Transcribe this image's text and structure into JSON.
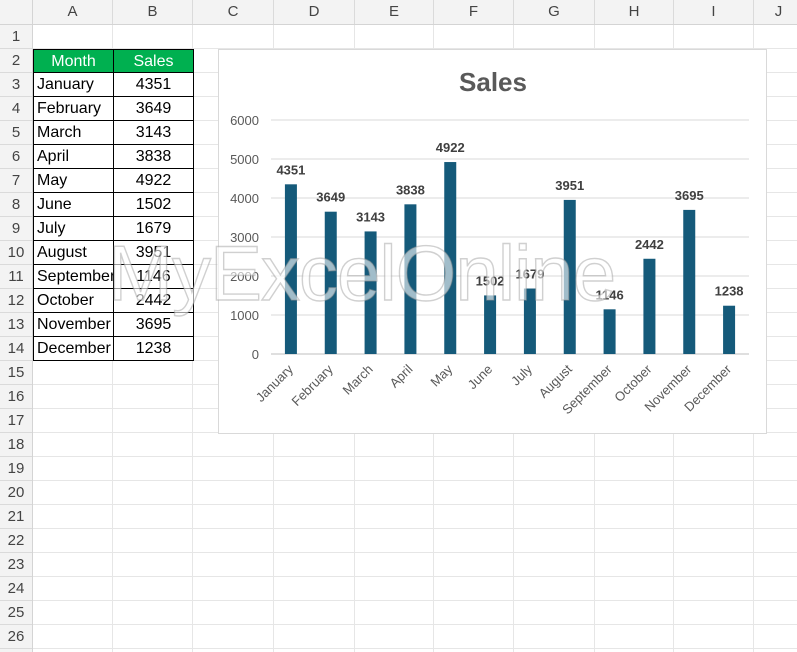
{
  "sheet": {
    "columns": [
      "A",
      "B",
      "C",
      "D",
      "E",
      "F",
      "G",
      "H",
      "I",
      "J"
    ],
    "rows": [
      "1",
      "2",
      "3",
      "4",
      "5",
      "6",
      "7",
      "8",
      "9",
      "10",
      "11",
      "12",
      "13",
      "14",
      "15",
      "16",
      "17",
      "18",
      "19",
      "20",
      "21",
      "22",
      "23",
      "24",
      "25",
      "26"
    ]
  },
  "table": {
    "headers": [
      "Month",
      "Sales"
    ],
    "header_color": "#00b050",
    "rows": [
      {
        "month": "January",
        "sales": "4351"
      },
      {
        "month": "February",
        "sales": "3649"
      },
      {
        "month": "March",
        "sales": "3143"
      },
      {
        "month": "April",
        "sales": "3838"
      },
      {
        "month": "May",
        "sales": "4922"
      },
      {
        "month": "June",
        "sales": "1502"
      },
      {
        "month": "July",
        "sales": "1679"
      },
      {
        "month": "August",
        "sales": "3951"
      },
      {
        "month": "September",
        "sales": "1146"
      },
      {
        "month": "October",
        "sales": "2442"
      },
      {
        "month": "November",
        "sales": "3695"
      },
      {
        "month": "December",
        "sales": "1238"
      }
    ]
  },
  "chart_data": {
    "type": "bar",
    "title": "Sales",
    "categories": [
      "January",
      "February",
      "March",
      "April",
      "May",
      "June",
      "July",
      "August",
      "September",
      "October",
      "November",
      "December"
    ],
    "values": [
      4351,
      3649,
      3143,
      3838,
      4922,
      1502,
      1679,
      3951,
      1146,
      2442,
      3695,
      1238
    ],
    "yticks": [
      "0",
      "1000",
      "2000",
      "3000",
      "4000",
      "5000",
      "6000"
    ],
    "ylim": [
      0,
      6000
    ],
    "grid": true,
    "bar_color": "#155a7a",
    "data_labels": true
  },
  "watermark": "MyExcelOnline"
}
